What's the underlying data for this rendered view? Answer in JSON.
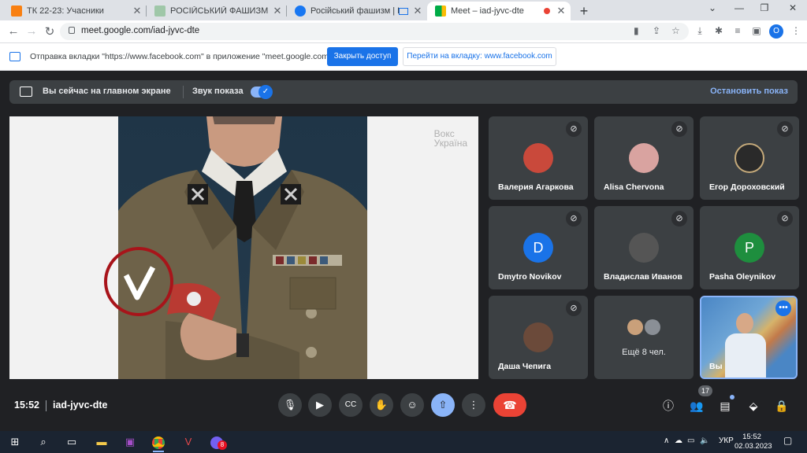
{
  "browser": {
    "tabs": [
      {
        "title": "ТК 22-23: Учасники",
        "favicon_color": "#f98012"
      },
      {
        "title": "РОСІЙСЬКИЙ ФАШИЗМ",
        "favicon_color": "#9fc7a8"
      },
      {
        "title": "Російський фашизм | Росій",
        "favicon_color": "#1877f2"
      },
      {
        "title": "Meet – iad-jyvc-dte",
        "favicon_color": "#00ac47"
      }
    ],
    "url": "meet.google.com/iad-jyvc-dte",
    "profile_initial": "O"
  },
  "infobar": {
    "message": "Отправка вкладки \"https://www.facebook.com\" в приложение \"meet.google.com\"...",
    "allow_label": "Закрыть доступ",
    "switch_label": "Перейти на вкладку: www.facebook.com"
  },
  "meet": {
    "presenting_text": "Вы сейчас на главном экране",
    "audio_label": "Звук показа",
    "stop_label": "Остановить показ",
    "watermark_line1": "Вокс",
    "watermark_line2": "Україна",
    "participants": [
      {
        "name": "Валерия Агаркова",
        "avatar": "photo",
        "color": "#c9493b"
      },
      {
        "name": "Alisa Chervona",
        "avatar": "photo",
        "color": "#d9a3a0"
      },
      {
        "name": "Егор Дороховский",
        "avatar": "photo",
        "color": "#2a2a2a"
      },
      {
        "name": "Dmytro Novikov",
        "avatar": "D",
        "color": "#1a73e8"
      },
      {
        "name": "Владислав Иванов",
        "avatar": "photo",
        "color": "#555555"
      },
      {
        "name": "Pasha Oleynikov",
        "avatar": "P",
        "color": "#1e8e3e"
      },
      {
        "name": "Даша Чепига",
        "avatar": "photo",
        "color": "#6b4a3a"
      }
    ],
    "more_label": "Ещё 8 чел.",
    "self_label": "Вы",
    "time": "15:52",
    "meeting_code": "iad-jyvc-dte",
    "participant_count": "17"
  },
  "taskbar": {
    "language": "УКР",
    "time": "15:52",
    "date": "02.03.2023",
    "viber_badge": "8"
  }
}
